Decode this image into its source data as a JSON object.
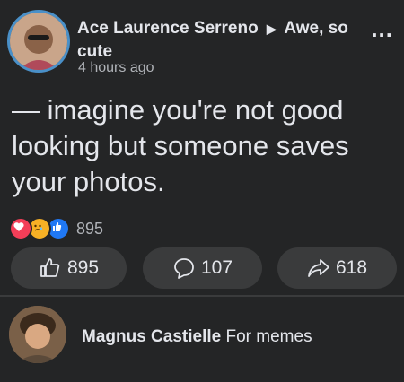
{
  "post": {
    "author": "Ace Laurence Serreno",
    "arrow": "▶",
    "group": "Awe, so cute",
    "time": "4 hours ago",
    "text": "— imagine you're not good looking but someone saves your photos.",
    "reactions_count": "895",
    "likes": "895",
    "comments": "107",
    "shares": "618",
    "more": "..."
  },
  "comment": {
    "author": "Magnus Castielle",
    "text": "For memes"
  },
  "colors": {
    "background": "#242526",
    "button": "#3a3b3c",
    "text": "#e4e6eb",
    "muted": "#b0b3b8",
    "love": "#f33e58",
    "sad": "#f7b125",
    "like": "#2078f4"
  }
}
